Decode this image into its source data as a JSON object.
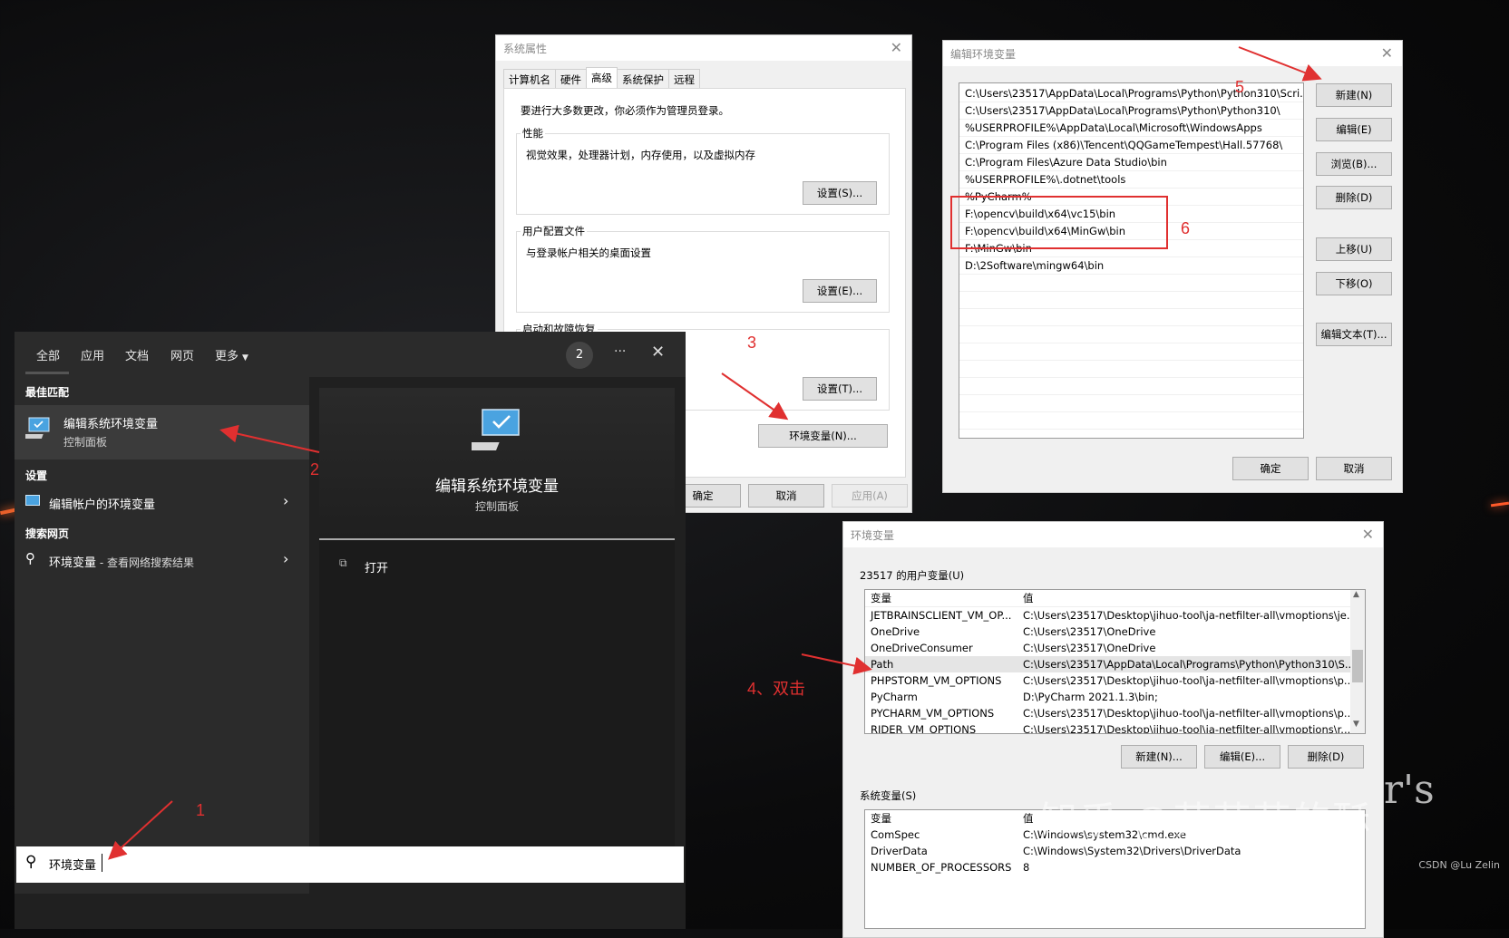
{
  "sysprops": {
    "title": "系统属性",
    "tabs": [
      "计算机名",
      "硬件",
      "高级",
      "系统保护",
      "远程"
    ],
    "admin_note": "要进行大多数更改，你必须作为管理员登录。",
    "perf_label": "性能",
    "perf_desc": "视觉效果，处理器计划，内存使用，以及虚拟内存",
    "perf_btn": "设置(S)...",
    "profile_label": "用户配置文件",
    "profile_desc": "与登录帐户相关的桌面设置",
    "profile_btn": "设置(E)...",
    "startup_label": "启动和故障恢复",
    "startup_btn": "设置(T)...",
    "env_btn": "环境变量(N)...",
    "ok": "确定",
    "cancel": "取消",
    "apply": "应用(A)"
  },
  "editenv": {
    "title": "编辑环境变量",
    "paths": [
      "C:\\Users\\23517\\AppData\\Local\\Programs\\Python\\Python310\\Scri...",
      "C:\\Users\\23517\\AppData\\Local\\Programs\\Python\\Python310\\",
      "%USERPROFILE%\\AppData\\Local\\Microsoft\\WindowsApps",
      "C:\\Program Files (x86)\\Tencent\\QQGameTempest\\Hall.57768\\",
      "C:\\Program Files\\Azure Data Studio\\bin",
      "%USERPROFILE%\\.dotnet\\tools",
      "%PyCharm%",
      "F:\\opencv\\build\\x64\\vc15\\bin",
      "F:\\opencv\\build\\x64\\MinGw\\bin",
      "F:\\MinGw\\bin",
      "D:\\2Software\\mingw64\\bin"
    ],
    "btn_new": "新建(N)",
    "btn_edit": "编辑(E)",
    "btn_browse": "浏览(B)...",
    "btn_delete": "删除(D)",
    "btn_up": "上移(U)",
    "btn_down": "下移(O)",
    "btn_edittext": "编辑文本(T)...",
    "ok": "确定",
    "cancel": "取消"
  },
  "envvars": {
    "title": "环境变量",
    "user_label": "23517 的用户变量(U)",
    "col_var": "变量",
    "col_val": "值",
    "user_rows": [
      {
        "var": "JETBRAINSCLIENT_VM_OP...",
        "val": "C:\\Users\\23517\\Desktop\\jihuo-tool\\ja-netfilter-all\\vmoptions\\je..."
      },
      {
        "var": "OneDrive",
        "val": "C:\\Users\\23517\\OneDrive"
      },
      {
        "var": "OneDriveConsumer",
        "val": "C:\\Users\\23517\\OneDrive"
      },
      {
        "var": "Path",
        "val": "C:\\Users\\23517\\AppData\\Local\\Programs\\Python\\Python310\\S..."
      },
      {
        "var": "PHPSTORM_VM_OPTIONS",
        "val": "C:\\Users\\23517\\Desktop\\jihuo-tool\\ja-netfilter-all\\vmoptions\\p..."
      },
      {
        "var": "PyCharm",
        "val": "D:\\PyCharm 2021.1.3\\bin;"
      },
      {
        "var": "PYCHARM_VM_OPTIONS",
        "val": "C:\\Users\\23517\\Desktop\\jihuo-tool\\ja-netfilter-all\\vmoptions\\p..."
      },
      {
        "var": "RIDER_VM_OPTIONS",
        "val": "C:\\Users\\23517\\Desktop\\jihuo-tool\\ja-netfilter-all\\vmoptions\\r..."
      }
    ],
    "btn_new": "新建(N)...",
    "btn_edit": "编辑(E)...",
    "btn_delete": "删除(D)",
    "sys_label": "系统变量(S)",
    "sys_rows": [
      {
        "var": "ComSpec",
        "val": "C:\\Windows\\system32\\cmd.exe"
      },
      {
        "var": "DriverData",
        "val": "C:\\Windows\\System32\\Drivers\\DriverData"
      },
      {
        "var": "NUMBER_OF_PROCESSORS",
        "val": "8"
      }
    ]
  },
  "search": {
    "tabs": [
      "全部",
      "应用",
      "文档",
      "网页",
      "更多"
    ],
    "badge": "2",
    "more_icon": "···",
    "best_match_title": "最佳匹配",
    "best_match_name": "编辑系统环境变量",
    "best_match_sub": "控制面板",
    "settings_title": "设置",
    "settings_item": "编辑帐户的环境变量",
    "web_title": "搜索网页",
    "web_item": "环境变量",
    "web_item_suffix": " - 查看网络搜索结果",
    "preview_name": "编辑系统环境变量",
    "preview_sub": "控制面板",
    "open_label": "打开",
    "query": "环境变量"
  },
  "annotations": {
    "n1": "1",
    "n2": "2",
    "n3": "3",
    "n4": "4、双击",
    "n5": "5",
    "n6": "6",
    "watermark": "知乎 @苏苏苏的酥",
    "csdn": "CSDN @Lu Zelin",
    "tail": "r's"
  },
  "colors": {
    "annotation_red": "#e03030",
    "search_bg": "#202020"
  }
}
